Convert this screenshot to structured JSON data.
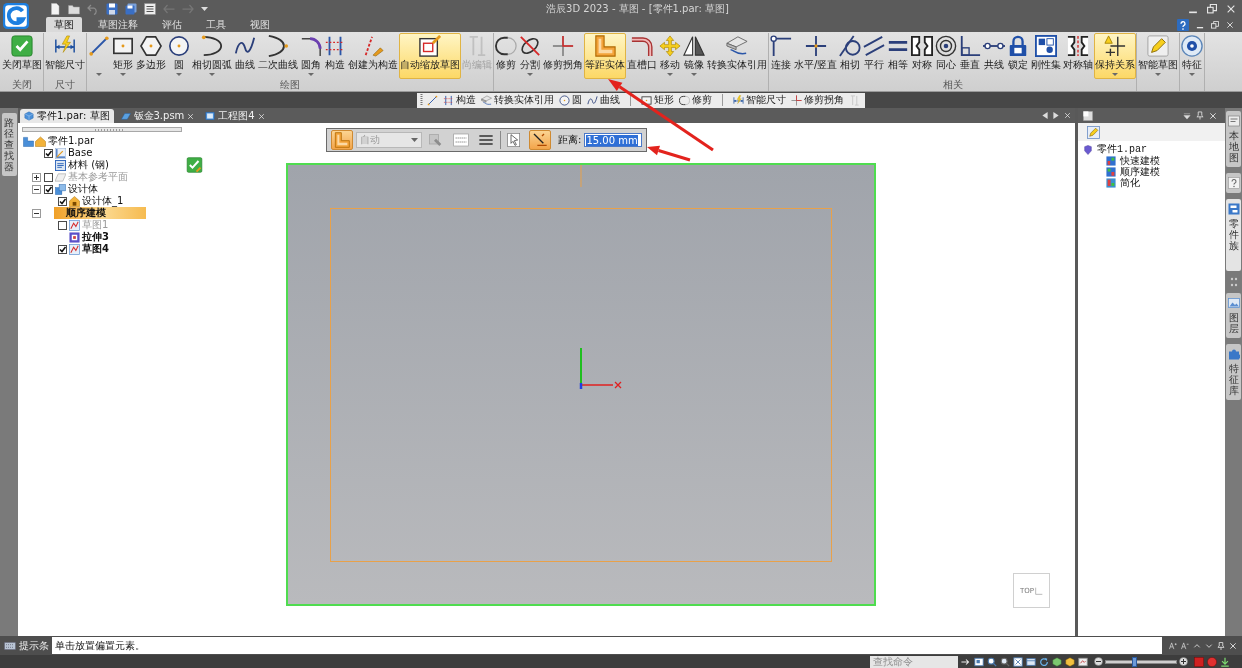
{
  "window": {
    "title": "浩辰3D 2023 - 草图 - [零件1.par: 草图]"
  },
  "ribbon_tabs": [
    {
      "label": "草图",
      "selected": true
    },
    {
      "label": "草图注释",
      "selected": false
    },
    {
      "label": "评估",
      "selected": false
    },
    {
      "label": "工具",
      "selected": false
    },
    {
      "label": "视图",
      "selected": false
    }
  ],
  "ribbon": {
    "groups": [
      {
        "label": "关闭",
        "items": [
          {
            "label": "关闭草图",
            "selected": false,
            "disabled": false,
            "dropdown": false
          }
        ]
      },
      {
        "label": "尺寸",
        "items": [
          {
            "label": "智能尺寸",
            "selected": false,
            "disabled": false,
            "dropdown": false
          }
        ]
      },
      {
        "label": "绘图",
        "items": [
          {
            "selected": false,
            "disabled": false,
            "dropdown": true
          },
          {
            "label": "矩形",
            "selected": false,
            "disabled": false,
            "dropdown": true
          },
          {
            "label": "多边形",
            "selected": false,
            "disabled": false,
            "dropdown": false
          },
          {
            "label": "圆",
            "selected": false,
            "disabled": false,
            "dropdown": true
          },
          {
            "label": "相切圆弧",
            "selected": false,
            "disabled": false,
            "dropdown": true
          },
          {
            "label": "曲线",
            "selected": false,
            "disabled": false,
            "dropdown": false
          },
          {
            "label": "二次曲线",
            "selected": false,
            "disabled": false,
            "dropdown": false
          },
          {
            "label": "圆角",
            "selected": false,
            "disabled": false,
            "dropdown": true
          },
          {
            "label": "构造",
            "selected": false,
            "disabled": false,
            "dropdown": false
          },
          {
            "label": "创建为构造",
            "selected": false,
            "disabled": false,
            "dropdown": false
          },
          {
            "label": "自动缩放草图",
            "selected": true,
            "disabled": false,
            "dropdown": false
          },
          {
            "label": "尚编辑",
            "selected": false,
            "disabled": true,
            "dropdown": false
          }
        ]
      },
      {
        "items": [
          {
            "label": "修剪",
            "selected": false,
            "disabled": false,
            "dropdown": false
          },
          {
            "label": "分割",
            "selected": false,
            "disabled": false,
            "dropdown": true
          },
          {
            "label": "修剪拐角",
            "selected": false,
            "disabled": false,
            "dropdown": false
          },
          {
            "label": "等距实体",
            "selected": true,
            "disabled": false,
            "dropdown": false
          },
          {
            "label": "直槽口",
            "selected": false,
            "disabled": false,
            "dropdown": false
          },
          {
            "label": "移动",
            "selected": false,
            "disabled": false,
            "dropdown": true
          },
          {
            "label": "镜像",
            "selected": false,
            "disabled": false,
            "dropdown": true
          },
          {
            "label": "转换实体引用",
            "selected": false,
            "disabled": false,
            "dropdown": false
          }
        ]
      },
      {
        "label": "相关",
        "items": [
          {
            "label": "连接",
            "selected": false,
            "disabled": false,
            "dropdown": false
          },
          {
            "label": "水平/竖直",
            "selected": false,
            "disabled": false,
            "dropdown": false
          },
          {
            "label": "相切",
            "selected": false,
            "disabled": false,
            "dropdown": false
          },
          {
            "label": "平行",
            "selected": false,
            "disabled": false,
            "dropdown": false
          },
          {
            "label": "相等",
            "selected": false,
            "disabled": false,
            "dropdown": false
          },
          {
            "label": "对称",
            "selected": false,
            "disabled": false,
            "dropdown": false
          },
          {
            "label": "同心",
            "selected": false,
            "disabled": false,
            "dropdown": false
          },
          {
            "label": "垂直",
            "selected": false,
            "disabled": false,
            "dropdown": false
          },
          {
            "label": "共线",
            "selected": false,
            "disabled": false,
            "dropdown": false
          },
          {
            "label": "锁定",
            "selected": false,
            "disabled": false,
            "dropdown": false
          },
          {
            "label": "刚性集",
            "selected": false,
            "disabled": false,
            "dropdown": false
          },
          {
            "label": "对称轴",
            "selected": false,
            "disabled": false,
            "dropdown": false
          },
          {
            "label": "保持关系",
            "selected": true,
            "disabled": false,
            "dropdown": true
          }
        ]
      },
      {
        "items": [
          {
            "label": "智能草图",
            "selected": false,
            "disabled": false,
            "dropdown": true
          }
        ]
      },
      {
        "items": [
          {
            "label": "特征",
            "selected": false,
            "disabled": false,
            "dropdown": true
          }
        ]
      }
    ]
  },
  "quick_bar": {
    "items": [
      {
        "disabled": false
      },
      {
        "label": "构造",
        "disabled": false
      },
      {
        "label": "转换实体引用",
        "disabled": false
      },
      {
        "label": "圆",
        "disabled": false
      },
      {
        "label": "曲线",
        "disabled": false
      },
      {
        "label": "矩形",
        "disabled": false
      },
      {
        "label": "修剪",
        "disabled": false
      },
      {
        "label": "智能尺寸",
        "disabled": false
      },
      {
        "label": "修剪拐角",
        "disabled": false
      },
      {
        "disabled": true
      }
    ]
  },
  "document_tabs": [
    {
      "label": "零件1.par: 草图",
      "kind": "part",
      "selected": true,
      "closable": false
    },
    {
      "label": "钣金3.psm",
      "kind": "sheetmetal",
      "selected": false,
      "closable": true
    },
    {
      "label": "工程图4",
      "kind": "drawing",
      "selected": false,
      "closable": true
    }
  ],
  "side_tabs_left": [
    {
      "label": "路径查找器",
      "selected": false
    }
  ],
  "floating_toolbar": {
    "buttons": [
      {
        "selected": true,
        "disabled": false
      },
      {
        "selected": false,
        "disabled": true
      },
      {
        "selected": false,
        "disabled": false
      },
      {
        "selected": false,
        "disabled": false
      },
      {
        "selected": false,
        "disabled": false
      },
      {
        "selected": true,
        "disabled": false
      }
    ],
    "mode": {
      "value": "自动",
      "disabled": true
    },
    "distance": {
      "label": "距离:",
      "value": "15.00 mm"
    }
  },
  "model_tree": [
    {
      "label": "零件1.par",
      "kind": "part",
      "selected": false,
      "bold": false,
      "children": [
        {
          "label": "Base",
          "kind": "coordinate",
          "checked": true,
          "selected": false,
          "bold": false
        },
        {
          "label": "材料 (钢)",
          "kind": "material",
          "selected": false,
          "bold": false
        },
        {
          "label": "基本参考平面",
          "kind": "plane",
          "checked": false,
          "expanded": false,
          "selected": false,
          "bold": false
        },
        {
          "label": "设计体",
          "kind": "body",
          "checked": true,
          "expanded": true,
          "selected": false,
          "bold": false,
          "children": [
            {
              "label": "设计体_1",
              "kind": "bodyitem",
              "checked": true,
              "selected": false,
              "bold": false
            }
          ]
        },
        {
          "label": "顺序建模",
          "kind": "group",
          "expanded": true,
          "selected": true,
          "bold": true,
          "children": [
            {
              "label": "草图1",
              "kind": "sketch",
              "checked": false,
              "selected": false,
              "bold": false
            },
            {
              "label": "拉伸3",
              "kind": "feature",
              "selected": false,
              "bold": true
            },
            {
              "label": "草图4",
              "kind": "sketch",
              "checked": true,
              "selected": false,
              "bold": true
            }
          ]
        }
      ]
    }
  ],
  "view_cube": {
    "label": "TOP"
  },
  "right_panel": {
    "tree": [
      {
        "label": "零件1.par",
        "kind": "part",
        "selected": false,
        "children": [
          {
            "label": "快速建模",
            "kind": "quick",
            "selected": false
          },
          {
            "label": "顺序建模",
            "kind": "ordered",
            "selected": false
          },
          {
            "label": "简化",
            "kind": "simplified",
            "selected": false
          }
        ]
      }
    ]
  },
  "side_tabs_right": [
    {
      "label": "本地图",
      "selected": false
    },
    {
      "selected": false
    },
    {
      "label": "零件族",
      "selected": true
    },
    {
      "label": "图层",
      "selected": false
    },
    {
      "label": "特征库",
      "selected": false
    }
  ],
  "status_bar": {
    "label": "提示条",
    "message": "单击放置偏置元素。"
  },
  "command_bar": {
    "placeholder": "查找命令",
    "zoom_slider": {
      "level": 0.4
    }
  }
}
